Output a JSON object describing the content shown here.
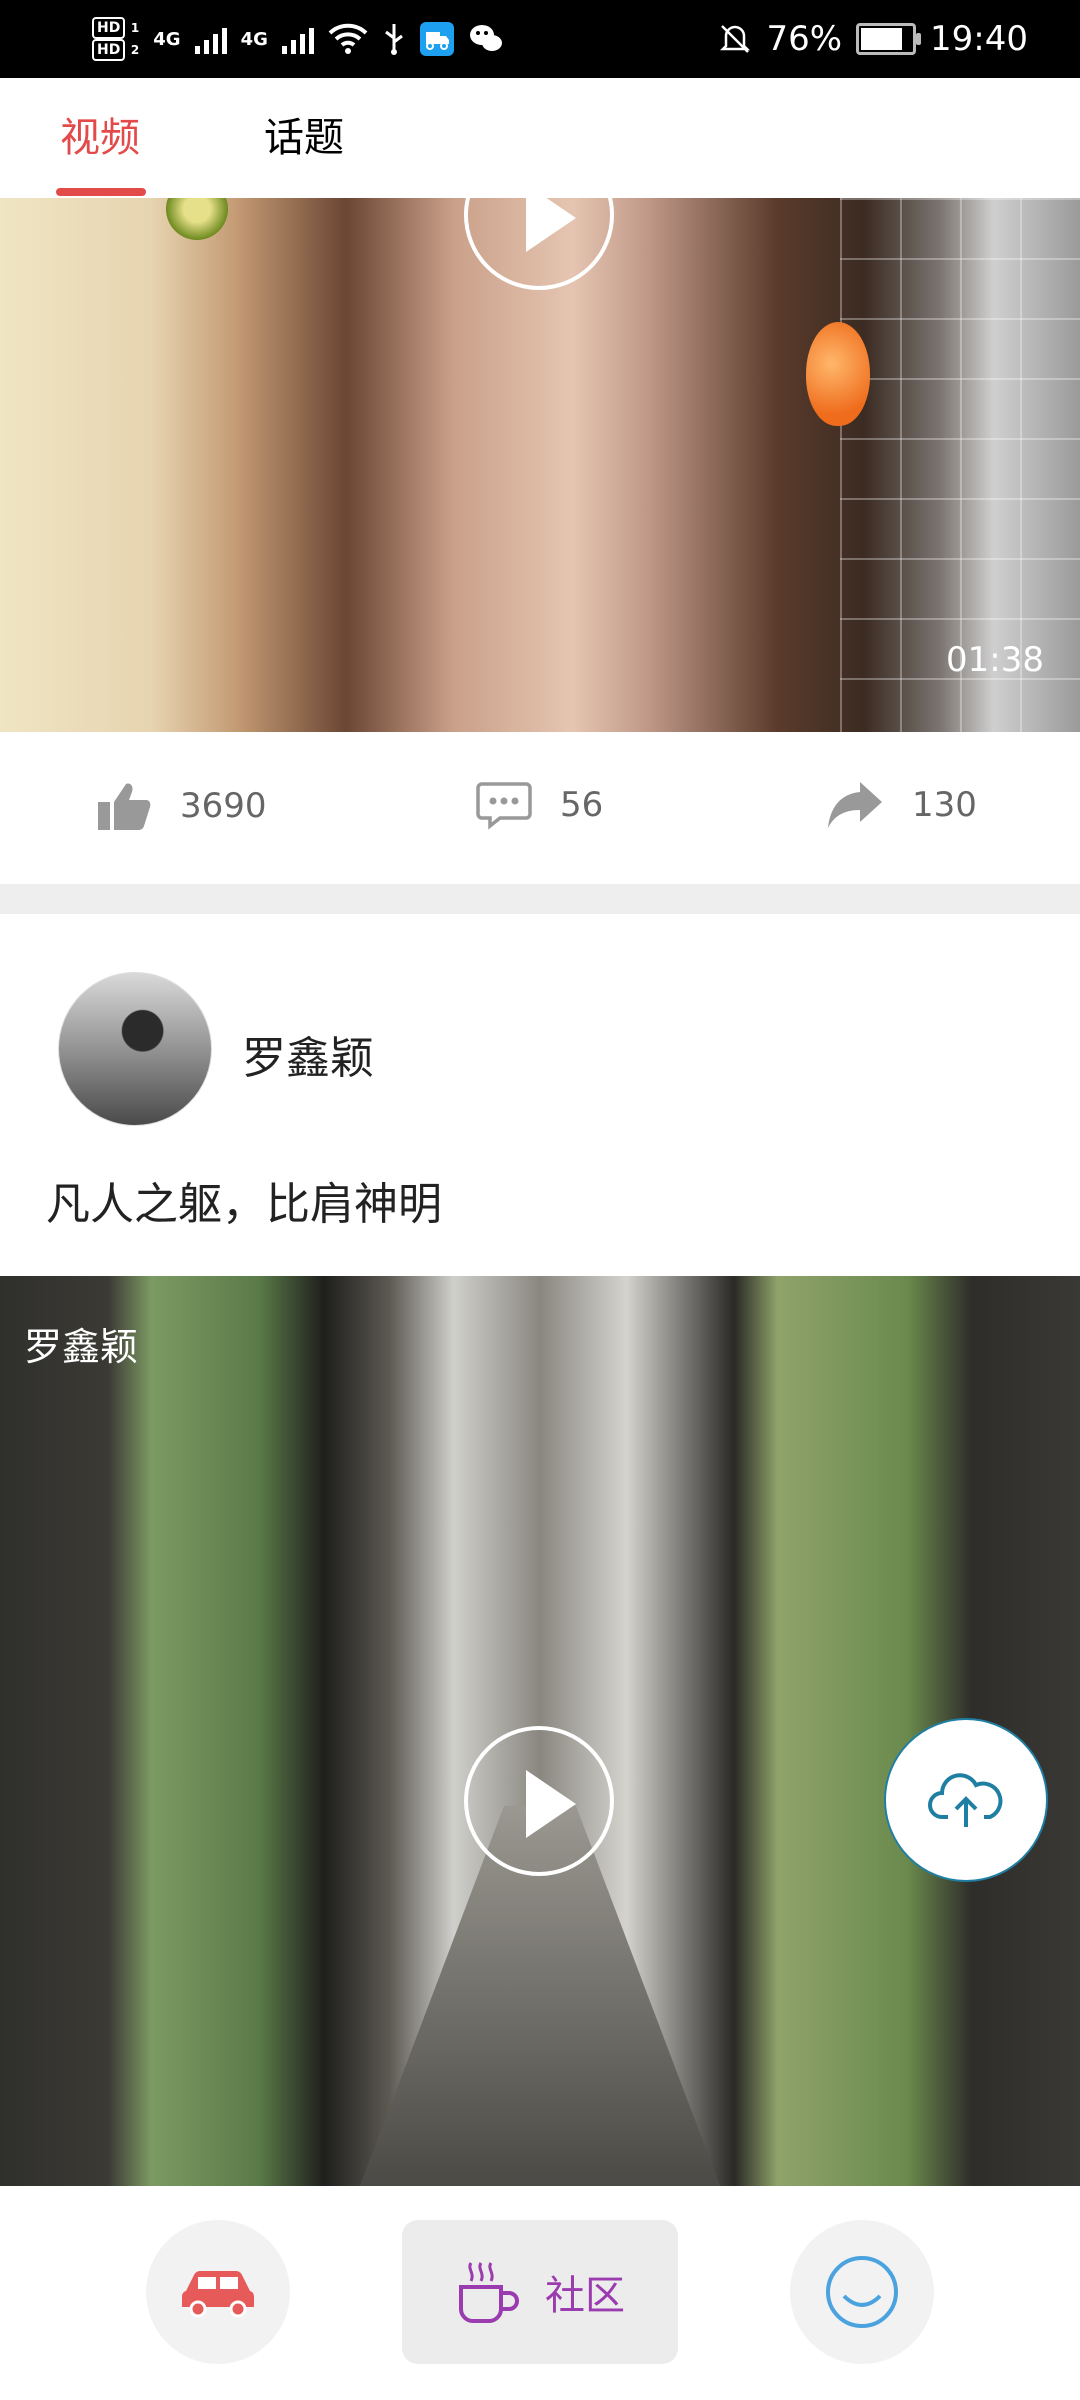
{
  "status_bar": {
    "hd1": "HD",
    "hd2": "HD",
    "net1": "4G",
    "net2": "4G",
    "battery_percent": "76%",
    "time": "19:40",
    "battery_level": 0.76
  },
  "tabs": [
    {
      "label": "视频",
      "active": true
    },
    {
      "label": "话题",
      "active": false
    }
  ],
  "video1": {
    "duration": "01:38"
  },
  "actions": {
    "likes": "3690",
    "comments": "56",
    "shares": "130"
  },
  "post": {
    "username": "罗鑫颖",
    "caption": "凡人之躯，比肩神明"
  },
  "video2": {
    "overlay_name": "罗鑫颖"
  },
  "bottom_nav": {
    "community_label": "社区"
  },
  "colors": {
    "accent": "#e34b4b",
    "nav_active": "#9b3bb0",
    "upload": "#1f7fa3"
  }
}
